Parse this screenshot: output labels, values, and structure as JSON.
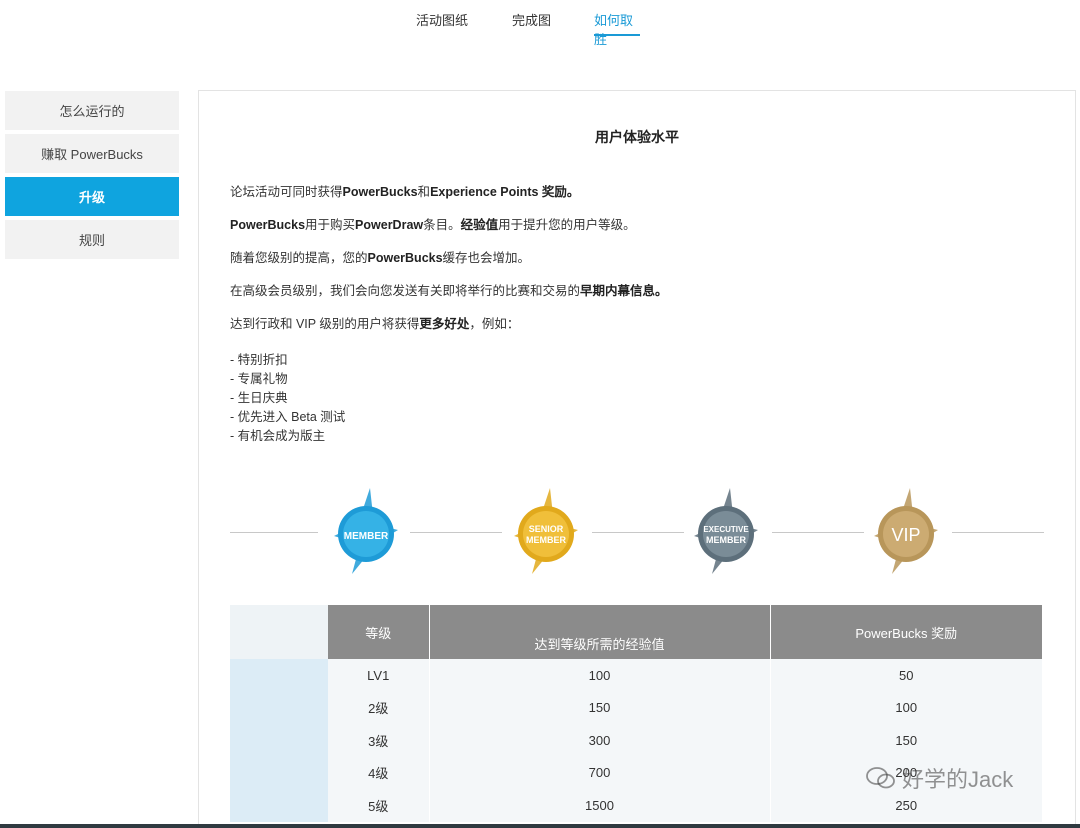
{
  "tabs": [
    {
      "label": "活动图纸"
    },
    {
      "label": "完成图"
    },
    {
      "label": "如何取胜"
    }
  ],
  "sidebar": {
    "items": [
      {
        "label": "怎么运行的"
      },
      {
        "label": "赚取 PowerBucks"
      },
      {
        "label": "升级"
      },
      {
        "label": "规则"
      }
    ]
  },
  "main": {
    "title": "用户体验水平",
    "paragraphs": [
      {
        "t1": "论坛活动可同时获得",
        "b1": "PowerBucks",
        "t2": "和",
        "b2": "Experience Points 奖励。",
        "t3": ""
      },
      {
        "t1": "",
        "b1": "PowerBucks",
        "t2": "用于购买",
        "b2": "PowerDraw",
        "t3": "条目。",
        "b3": "经验值",
        "t4": "用于提升您的用户等级。"
      },
      {
        "t1": "随着您级别的提高，您的",
        "b1": "PowerBucks",
        "t2": "缓存也会增加。"
      },
      {
        "t1": "在高级会员级别，我们会向您发送有关即将举行的比赛和交易的",
        "b1": "早期内幕信息。"
      },
      {
        "t1": "达到行政和 VIP 级别的用户将获得",
        "b1": "更多好处",
        "t2": "，例如："
      }
    ],
    "benefits": [
      "- 特别折扣",
      "- 专属礼物",
      "- 生日庆典",
      "- 优先进入 Beta 测试",
      "- 有机会成为版主"
    ],
    "badges": [
      {
        "label_top": "",
        "label": "MEMBER",
        "color": "#1e9bd7"
      },
      {
        "label_top": "SENIOR",
        "label": "MEMBER",
        "color": "#e1a91c"
      },
      {
        "label_top": "EXECUTIVE",
        "label": "MEMBER",
        "color": "#5d6f7b"
      },
      {
        "label_top": "",
        "label": "VIP",
        "color": "#b8965a"
      }
    ]
  },
  "table": {
    "headers": [
      "等级",
      "达到等级所需的经验值",
      "PowerBucks 奖励"
    ],
    "rows": [
      [
        "LV1",
        "100",
        "50"
      ],
      [
        "2级",
        "150",
        "100"
      ],
      [
        "3级",
        "300",
        "150"
      ],
      [
        "4级",
        "700",
        "200"
      ],
      [
        "5级",
        "1500",
        "250"
      ]
    ]
  },
  "watermark": "好学的Jack"
}
